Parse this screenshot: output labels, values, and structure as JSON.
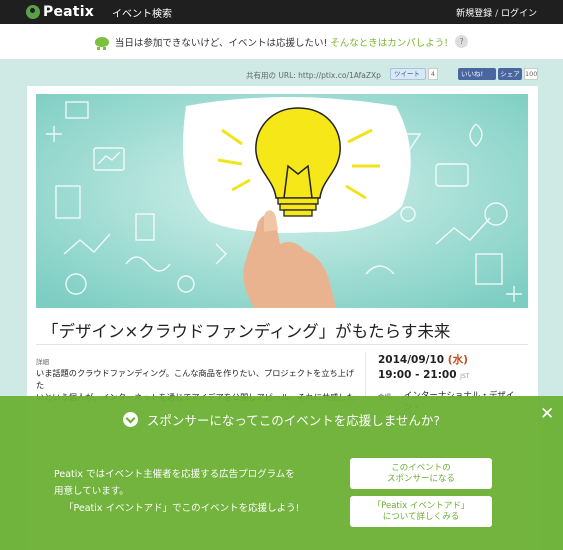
{
  "nav": {
    "brand": "Peatix",
    "search": "イベント検索",
    "signup": "新規登録",
    "separator": "/",
    "login": "ログイン"
  },
  "banner": {
    "text": "当日は参加できないけど、イベントは応援したい!",
    "link": "そんなときはカンパしよう!",
    "help": "?"
  },
  "share": {
    "url_label": "共有用の URL: http://ptix.co/1AfaZXp",
    "tweet": "ツイート",
    "tweet_count": "4",
    "fb_like": "いいね!",
    "fb_share": "シェア",
    "fb_count": "100"
  },
  "event": {
    "title": "「デザイン×クラウドファンディング」がもたらす未来",
    "detail_label": "詳細",
    "detail_line1": "いま話題のクラウドファンディング。こんな商品を作りたい、プロジェクトを立ち上げた",
    "detail_line2": "いという個人が、インターネットを通じてアイデアを公開しアピール。それに共感した",
    "date": "2014/09/10",
    "dow": "(水)",
    "time": "19:00 - 21:00",
    "tz": "JST",
    "venue_label": "会場",
    "venue": "インターナショナル・デザイン・"
  },
  "sponsor": {
    "heading": "スポンサーになってこのイベントを応援しませんか?",
    "close": "✕",
    "body_line1": "Peatix ではイベント主催者を応援する広告プログラムを",
    "body_line2": "用意しています。",
    "body_line3": "「Peatix イベントアド」でこのイベントを応援しよう!",
    "btn1_line1": "このイベントの",
    "btn1_line2": "スポンサーになる",
    "btn2_line1": "「Peatix イベントアド」",
    "btn2_line2": "について詳しくみる"
  }
}
